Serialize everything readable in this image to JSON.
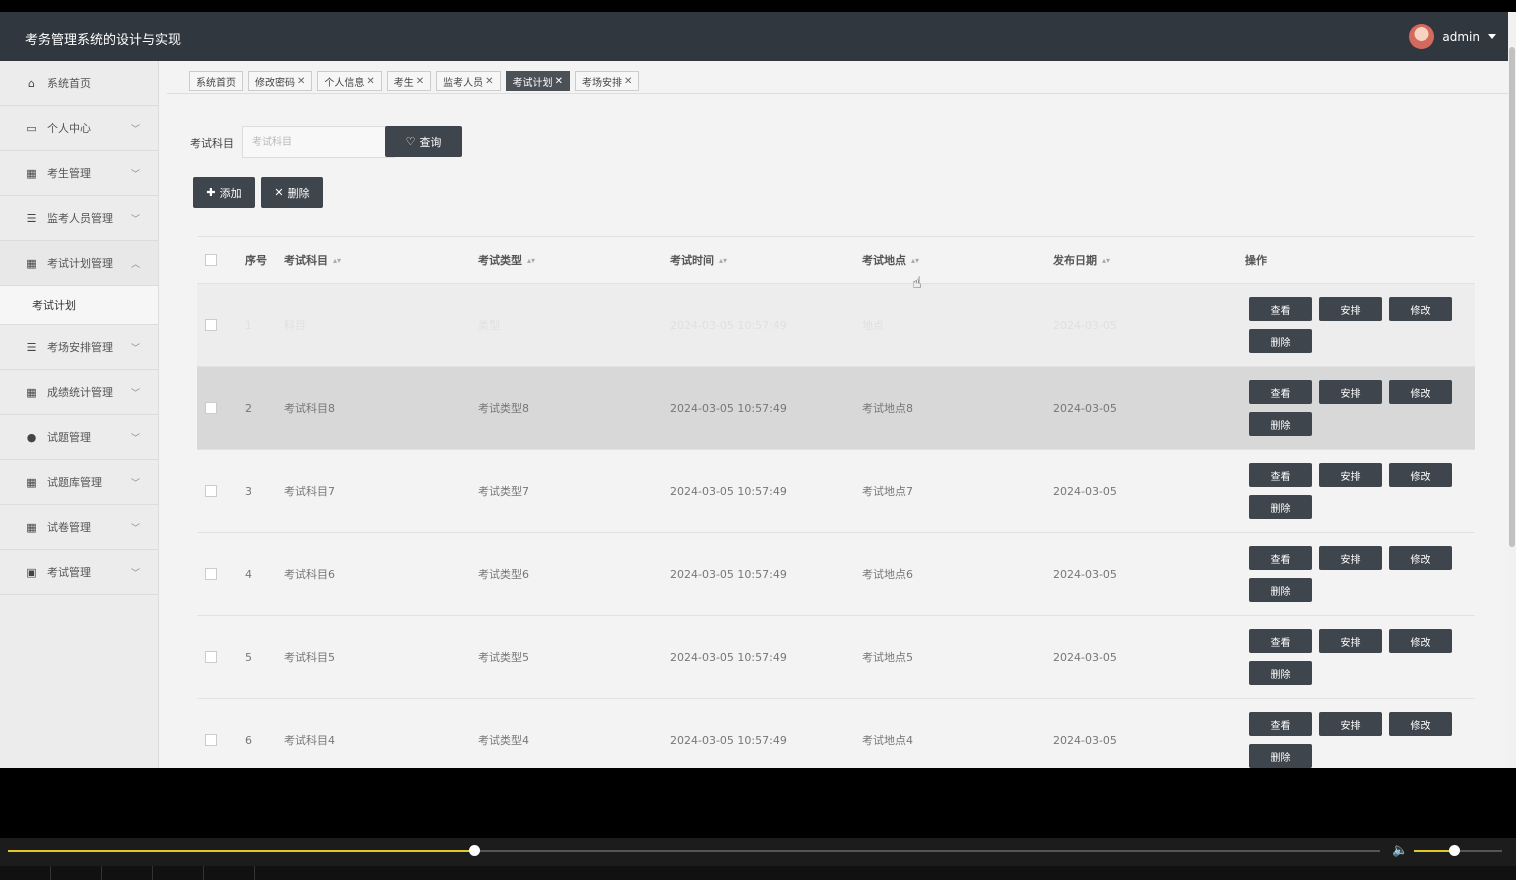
{
  "header": {
    "title": "考务管理系统的设计与实现",
    "user": "admin"
  },
  "sidebar": {
    "items": [
      {
        "label": "系统首页",
        "icon": "home-icon"
      },
      {
        "label": "个人中心",
        "icon": "calendar-icon"
      },
      {
        "label": "考生管理",
        "icon": "grid-icon"
      },
      {
        "label": "监考人员管理",
        "icon": "list-icon"
      },
      {
        "label": "考试计划管理",
        "icon": "grid-icon"
      },
      {
        "label": "考场安排管理",
        "icon": "list-icon"
      },
      {
        "label": "成绩统计管理",
        "icon": "grid-icon"
      },
      {
        "label": "试题管理",
        "icon": "user-icon"
      },
      {
        "label": "试题库管理",
        "icon": "grid-icon"
      },
      {
        "label": "试卷管理",
        "icon": "grid-icon"
      },
      {
        "label": "考试管理",
        "icon": "clipboard-icon"
      }
    ],
    "sub_item": "考试计划"
  },
  "tabs": [
    {
      "label": "系统首页",
      "closable": false
    },
    {
      "label": "修改密码",
      "closable": true
    },
    {
      "label": "个人信息",
      "closable": true
    },
    {
      "label": "考生",
      "closable": true
    },
    {
      "label": "监考人员",
      "closable": true
    },
    {
      "label": "考试计划",
      "closable": true,
      "active": true
    },
    {
      "label": "考场安排",
      "closable": true
    }
  ],
  "search": {
    "label": "考试科目",
    "placeholder": "考试科目",
    "button": "查询"
  },
  "toolbar": {
    "add": "添加",
    "delete": "删除"
  },
  "table": {
    "headers": {
      "index": "序号",
      "subject": "考试科目",
      "type": "考试类型",
      "time": "考试时间",
      "location": "考试地点",
      "date": "发布日期",
      "actions": "操作"
    },
    "rows": [
      {
        "index": "1",
        "subject": "科目",
        "type": "类型",
        "time": "2024-03-05 10:57:49",
        "location": "地点",
        "date": "2024-03-05"
      },
      {
        "index": "2",
        "subject": "考试科目8",
        "type": "考试类型8",
        "time": "2024-03-05 10:57:49",
        "location": "考试地点8",
        "date": "2024-03-05"
      },
      {
        "index": "3",
        "subject": "考试科目7",
        "type": "考试类型7",
        "time": "2024-03-05 10:57:49",
        "location": "考试地点7",
        "date": "2024-03-05"
      },
      {
        "index": "4",
        "subject": "考试科目6",
        "type": "考试类型6",
        "time": "2024-03-05 10:57:49",
        "location": "考试地点6",
        "date": "2024-03-05"
      },
      {
        "index": "5",
        "subject": "考试科目5",
        "type": "考试类型5",
        "time": "2024-03-05 10:57:49",
        "location": "考试地点5",
        "date": "2024-03-05"
      },
      {
        "index": "6",
        "subject": "考试科目4",
        "type": "考试类型4",
        "time": "2024-03-05 10:57:49",
        "location": "考试地点4",
        "date": "2024-03-05"
      }
    ],
    "actions": {
      "view": "查看",
      "arrange": "安排",
      "edit": "修改",
      "remove": "删除"
    }
  },
  "player": {
    "progress": 0.34,
    "volume": 0.45,
    "accent": "#e3c52d"
  }
}
